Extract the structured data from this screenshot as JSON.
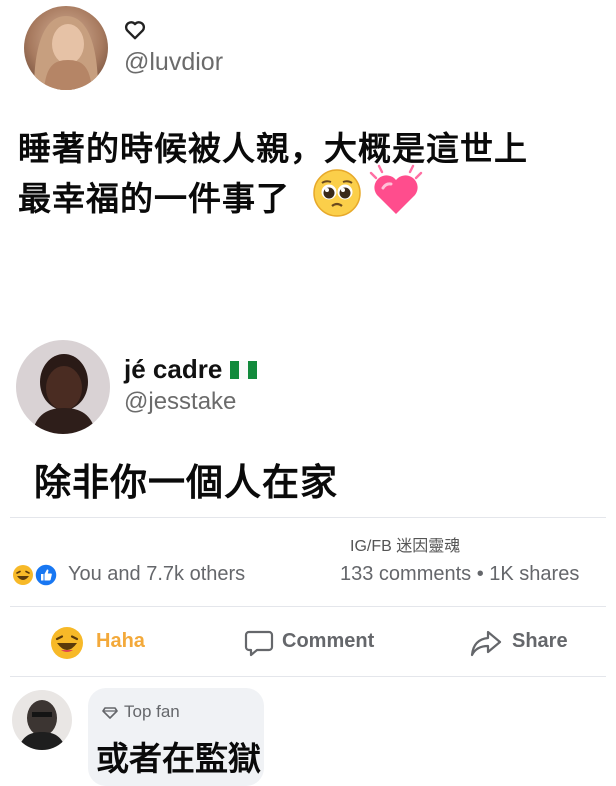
{
  "post1": {
    "username": "@luvdior",
    "text_line1": "睡著的時候被人親，大概是這世上",
    "text_line2": "最幸福的一件事了",
    "emoji1": "pleading-face",
    "emoji2": "growing-heart"
  },
  "post2": {
    "display_name": "jé cadre",
    "flag": "nigeria-flag",
    "username": "@jesstake",
    "text": "除非你一個人在家"
  },
  "watermark": "IG/FB 迷因靈魂",
  "stats": {
    "reactions": "You and 7.7k others",
    "comments_shares": "133 comments • 1K shares"
  },
  "actions": {
    "haha": "Haha",
    "comment": "Comment",
    "share": "Share"
  },
  "comment": {
    "badge": "Top fan",
    "text": "或者在監獄"
  },
  "colors": {
    "like_blue": "#1877f2",
    "haha_yellow": "#f7b928",
    "heart_pink": "#ff4d8d"
  }
}
